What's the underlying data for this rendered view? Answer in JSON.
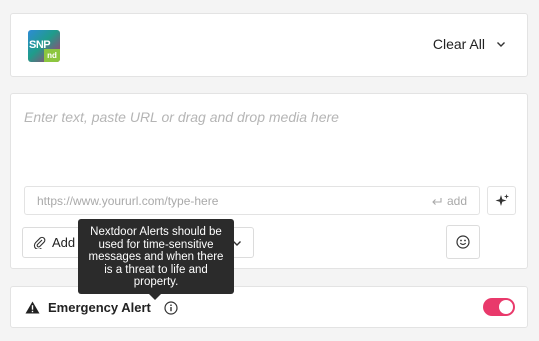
{
  "logo": {
    "main": "SNP",
    "sub": "nd"
  },
  "header": {
    "clear_all_label": "Clear All"
  },
  "composer": {
    "placeholder": "Enter text, paste URL or drag and drop media here",
    "url_placeholder": "https://www.yoururl.com/type-here",
    "url_add_label": "add",
    "link_button_label": "Add L"
  },
  "tooltip": {
    "text": "Nextdoor Alerts should be used for time-sensitive messages and when there is a threat to life and property."
  },
  "emergency": {
    "label": "Emergency Alert",
    "toggle_on": true,
    "toggle_color": "#e9396b"
  }
}
